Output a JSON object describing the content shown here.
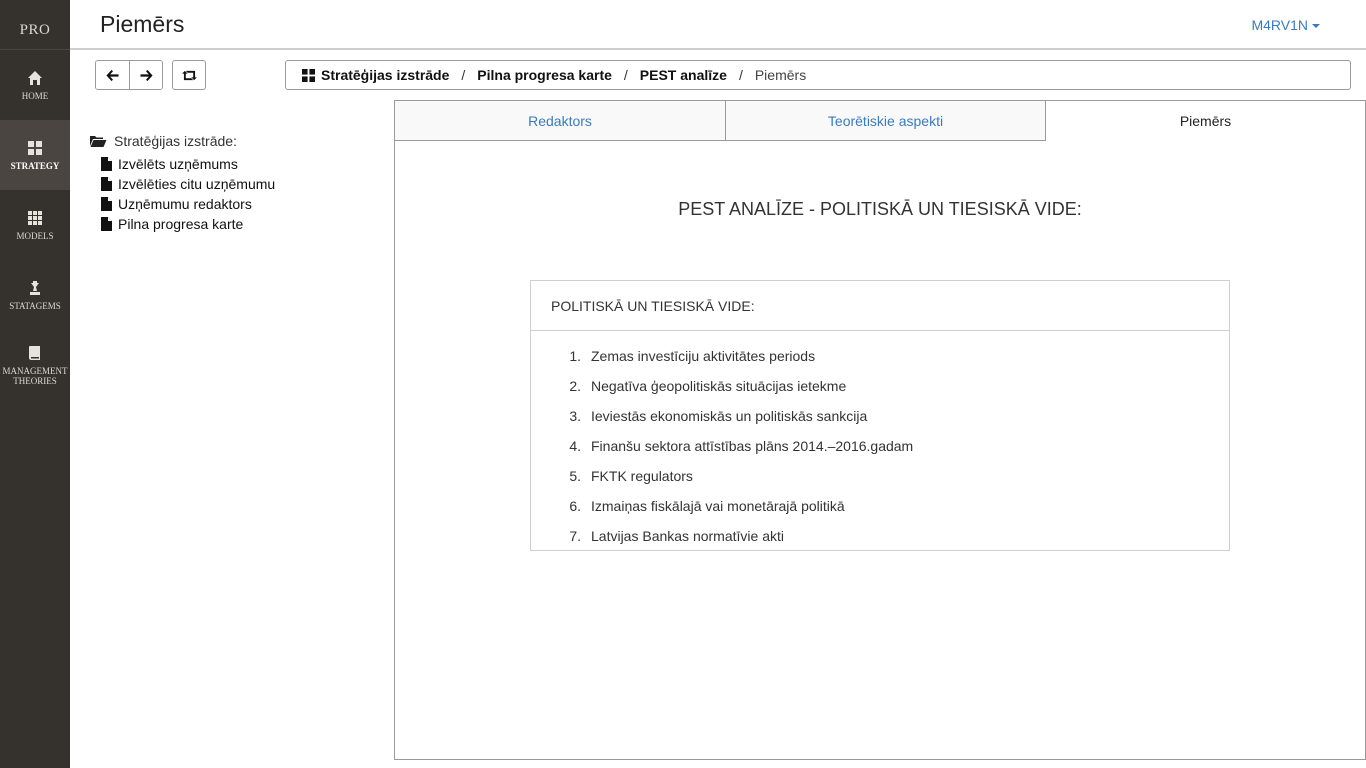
{
  "rail": {
    "brand": "PRO",
    "items": [
      {
        "label": "HOME",
        "icon": "home-icon"
      },
      {
        "label": "STRATEGY",
        "icon": "grid-icon"
      },
      {
        "label": "MODELS",
        "icon": "apps-icon"
      },
      {
        "label": "STATAGEMS",
        "icon": "chess-icon"
      },
      {
        "label": "MANAGEMENT THEORIES",
        "icon": "book-icon"
      }
    ]
  },
  "header": {
    "title": "Piemērs",
    "user": "M4RV1N"
  },
  "breadcrumb": {
    "items": [
      "Stratēģijas izstrāde",
      "Pilna progresa karte",
      "PEST analīze"
    ],
    "current": "Piemērs",
    "separator": "/"
  },
  "tree": {
    "root": "Stratēģijas izstrāde:",
    "items": [
      "Izvēlēts uzņēmums",
      "Izvēlēties citu uzņēmumu",
      "Uzņēmumu redaktors",
      "Pilna progresa karte"
    ]
  },
  "tabs": [
    "Redaktors",
    "Teorētiskie aspekti",
    "Piemērs"
  ],
  "content": {
    "heading": "PEST ANALĪZE - POLITISKĀ UN TIESISKĀ VIDE:",
    "box_title": "POLITISKĀ UN TIESISKĀ VIDE:",
    "items": [
      {
        "num": "1.",
        "text": "Zemas investīciju aktivitātes periods"
      },
      {
        "num": "2.",
        "text": "Negatīva ģeopolitiskās situācijas ietekme"
      },
      {
        "num": "3.",
        "text": "Ieviestās ekonomiskās un politiskās sankcija"
      },
      {
        "num": "4.",
        "text": "Finanšu sektora attīstības plāns 2014.–2016.gadam"
      },
      {
        "num": "5.",
        "text": "FKTK regulators"
      },
      {
        "num": "6.",
        "text": "Izmaiņas fiskālajā vai monetārajā politikā"
      },
      {
        "num": "7.",
        "text": "Latvijas Bankas normatīvie akti"
      }
    ]
  },
  "colors": {
    "rail_bg": "#35312d",
    "link": "#3a7bbf"
  }
}
